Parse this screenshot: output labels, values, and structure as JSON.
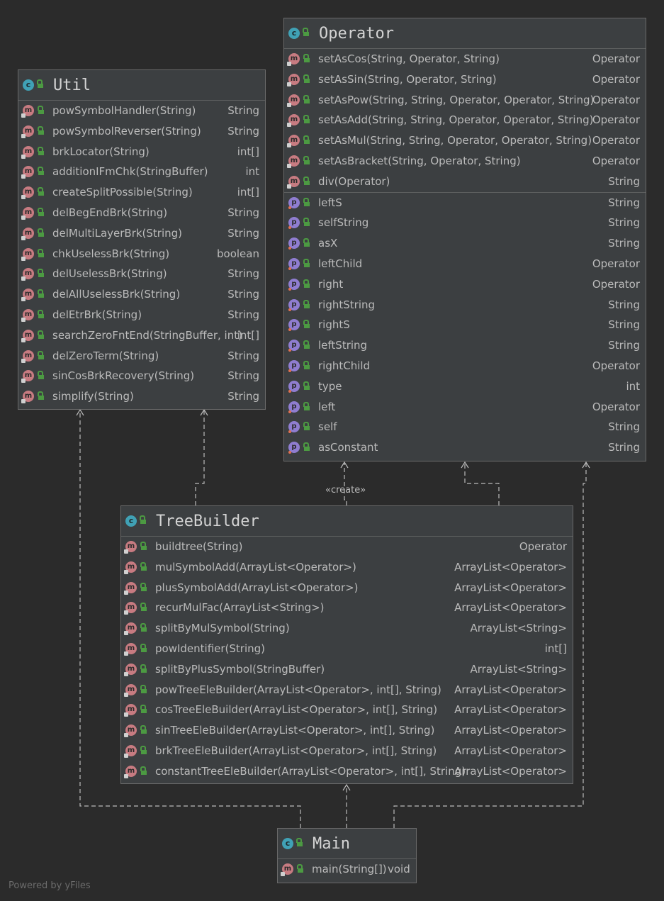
{
  "util": {
    "name": "Util",
    "methods": [
      {
        "name": "powSymbolHandler(String)",
        "type": "String"
      },
      {
        "name": "powSymbolReverser(String)",
        "type": "String"
      },
      {
        "name": "brkLocator(String)",
        "type": "int[]"
      },
      {
        "name": "additionIFmChk(StringBuffer)",
        "type": "int"
      },
      {
        "name": "createSplitPossible(String)",
        "type": "int[]"
      },
      {
        "name": "delBegEndBrk(String)",
        "type": "String"
      },
      {
        "name": "delMultiLayerBrk(String)",
        "type": "String"
      },
      {
        "name": "chkUselessBrk(String)",
        "type": "boolean"
      },
      {
        "name": "delUselessBrk(String)",
        "type": "String"
      },
      {
        "name": "delAllUselessBrk(String)",
        "type": "String"
      },
      {
        "name": "delEtrBrk(String)",
        "type": "String"
      },
      {
        "name": "searchZeroFntEnd(StringBuffer, int)",
        "type": "int[]"
      },
      {
        "name": "delZeroTerm(String)",
        "type": "String"
      },
      {
        "name": "sinCosBrkRecovery(String)",
        "type": "String"
      },
      {
        "name": "simplify(String)",
        "type": "String"
      }
    ]
  },
  "operator": {
    "name": "Operator",
    "methods": [
      {
        "name": "setAsCos(String, Operator, String)",
        "type": "Operator"
      },
      {
        "name": "setAsSin(String, Operator, String)",
        "type": "Operator"
      },
      {
        "name": "setAsPow(String, String, Operator, Operator, String)",
        "type": "Operator"
      },
      {
        "name": "setAsAdd(String, String, Operator, Operator, String)",
        "type": "Operator"
      },
      {
        "name": "setAsMul(String, String, Operator, Operator, String)",
        "type": "Operator"
      },
      {
        "name": "setAsBracket(String, Operator, String)",
        "type": "Operator"
      },
      {
        "name": "div(Operator)",
        "type": "String"
      }
    ],
    "fields": [
      {
        "name": "leftS",
        "type": "String"
      },
      {
        "name": "selfString",
        "type": "String"
      },
      {
        "name": "asX",
        "type": "String"
      },
      {
        "name": "leftChild",
        "type": "Operator"
      },
      {
        "name": "right",
        "type": "Operator"
      },
      {
        "name": "rightString",
        "type": "String"
      },
      {
        "name": "rightS",
        "type": "String"
      },
      {
        "name": "leftString",
        "type": "String"
      },
      {
        "name": "rightChild",
        "type": "Operator"
      },
      {
        "name": "type",
        "type": "int"
      },
      {
        "name": "left",
        "type": "Operator"
      },
      {
        "name": "self",
        "type": "String"
      },
      {
        "name": "asConstant",
        "type": "String"
      }
    ]
  },
  "treebuilder": {
    "name": "TreeBuilder",
    "methods": [
      {
        "name": "buildtree(String)",
        "type": "Operator"
      },
      {
        "name": "mulSymbolAdd(ArrayList<Operator>)",
        "type": "ArrayList<Operator>"
      },
      {
        "name": "plusSymbolAdd(ArrayList<Operator>)",
        "type": "ArrayList<Operator>"
      },
      {
        "name": "recurMulFac(ArrayList<String>)",
        "type": "ArrayList<Operator>"
      },
      {
        "name": "splitByMulSymbol(String)",
        "type": "ArrayList<String>"
      },
      {
        "name": "powIdentifier(String)",
        "type": "int[]"
      },
      {
        "name": "splitByPlusSymbol(StringBuffer)",
        "type": "ArrayList<String>"
      },
      {
        "name": "powTreeEleBuilder(ArrayList<Operator>, int[], String)",
        "type": "ArrayList<Operator>"
      },
      {
        "name": "cosTreeEleBuilder(ArrayList<Operator>, int[], String)",
        "type": "ArrayList<Operator>"
      },
      {
        "name": "sinTreeEleBuilder(ArrayList<Operator>, int[], String)",
        "type": "ArrayList<Operator>"
      },
      {
        "name": "brkTreeEleBuilder(ArrayList<Operator>, int[], String)",
        "type": "ArrayList<Operator>"
      },
      {
        "name": "constantTreeEleBuilder(ArrayList<Operator>, int[], String)",
        "type": "ArrayList<Operator>"
      }
    ]
  },
  "main": {
    "name": "Main",
    "methods": [
      {
        "name": "main(String[])",
        "type": "void"
      }
    ]
  },
  "edges": {
    "create_label": "«create»"
  },
  "footer": {
    "powered_by": "Powered by yFiles"
  }
}
